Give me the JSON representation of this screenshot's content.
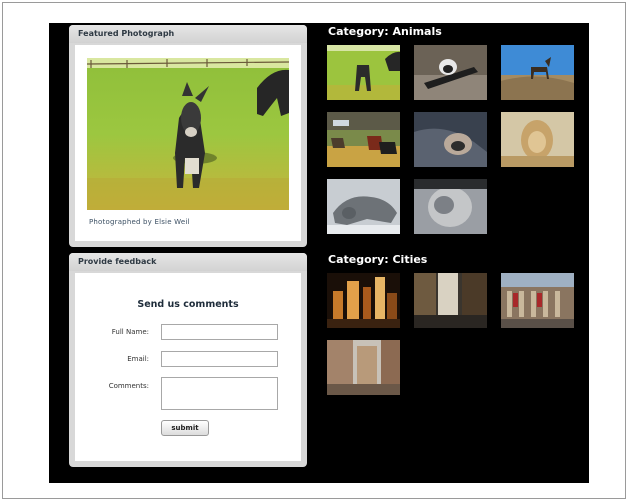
{
  "featured": {
    "header": "Featured Photograph",
    "caption": "Photographed by Elsie Weil"
  },
  "feedback": {
    "header": "Provide feedback",
    "title": "Send us comments",
    "fields": {
      "name_label": "Full Name:",
      "email_label": "Email:",
      "comments_label": "Comments:"
    },
    "submit_label": "submit"
  },
  "categories": [
    {
      "title": "Category: Animals",
      "thumbnail_count": 8
    },
    {
      "title": "Category: Cities",
      "thumbnail_count": 4
    }
  ]
}
